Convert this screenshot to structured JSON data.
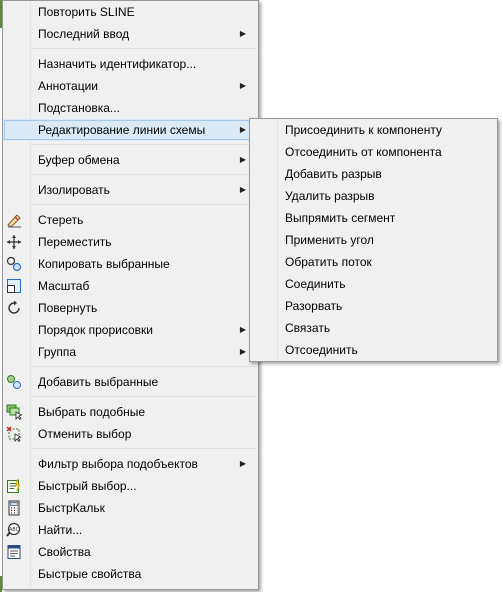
{
  "main_menu": {
    "items": [
      {
        "label": "Повторить SLINE"
      },
      {
        "label": "Последний ввод"
      },
      {
        "label": "Назначить идентификатор..."
      },
      {
        "label": "Аннотации"
      },
      {
        "label": "Подстановка..."
      },
      {
        "label": "Редактирование линии схемы"
      },
      {
        "label": "Буфер обмена"
      },
      {
        "label": "Изолировать"
      },
      {
        "label": "Стереть",
        "icon": "eraser-icon"
      },
      {
        "label": "Переместить",
        "icon": "move-icon"
      },
      {
        "label": "Копировать выбранные",
        "icon": "copy-icon"
      },
      {
        "label": "Масштаб",
        "icon": "scale-icon"
      },
      {
        "label": "Повернуть",
        "icon": "rotate-icon"
      },
      {
        "label": "Порядок прорисовки"
      },
      {
        "label": "Группа"
      },
      {
        "label": "Добавить выбранные",
        "icon": "add-selected-icon"
      },
      {
        "label": "Выбрать подобные",
        "icon": "select-similar-icon"
      },
      {
        "label": "Отменить выбор",
        "icon": "deselect-icon"
      },
      {
        "label": "Фильтр выбора подобъектов"
      },
      {
        "label": "Быстрый выбор...",
        "icon": "quick-select-icon"
      },
      {
        "label": "БыстрКальк",
        "icon": "calculator-icon"
      },
      {
        "label": "Найти...",
        "icon": "find-icon"
      },
      {
        "label": "Свойства",
        "icon": "properties-icon"
      },
      {
        "label": "Быстрые свойства"
      }
    ]
  },
  "submenu": {
    "parent": "Редактирование линии схемы",
    "items": [
      {
        "label": "Присоединить к компоненту"
      },
      {
        "label": "Отсоединить от компонента"
      },
      {
        "label": "Добавить разрыв"
      },
      {
        "label": "Удалить разрыв"
      },
      {
        "label": "Выпрямить сегмент"
      },
      {
        "label": "Применить угол"
      },
      {
        "label": "Обратить поток"
      },
      {
        "label": "Соединить"
      },
      {
        "label": "Разорвать"
      },
      {
        "label": "Связать"
      },
      {
        "label": "Отсоединить"
      }
    ]
  },
  "colors": {
    "menu_bg": "#f0f0f0",
    "highlight_bg": "#dce9f7",
    "highlight_border": "#a7c8ec",
    "border": "#979797"
  }
}
